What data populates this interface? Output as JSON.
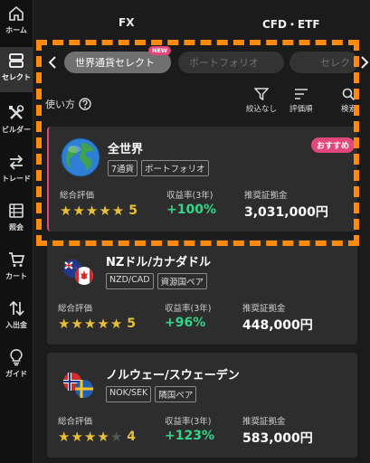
{
  "nav": [
    {
      "label": "ホーム",
      "icon": "home-icon"
    },
    {
      "label": "セレクト",
      "icon": "select-list-icon"
    },
    {
      "label": "ビルダー",
      "icon": "tools-icon"
    },
    {
      "label": "トレード",
      "icon": "trade-arrows-icon"
    },
    {
      "label": "照会",
      "icon": "inquiry-icon"
    },
    {
      "label": "カート",
      "icon": "cart-icon"
    },
    {
      "label": "入出金",
      "icon": "transfer-icon"
    },
    {
      "label": "ガイド",
      "icon": "lightbulb-icon"
    }
  ],
  "tabs": {
    "fx": "FX",
    "cfd": "CFD・ETF"
  },
  "chips": {
    "selected": "世界通貨セレクト",
    "new_badge": "NEW",
    "portfolio": "ポートフォリオ",
    "partial": "セレク"
  },
  "tools": {
    "usage": "使い方",
    "filter": "絞込なし",
    "sort": "評価順",
    "search": "検索"
  },
  "labels": {
    "rating": "総合評価",
    "return": "収益率(3年)",
    "margin": "推奨証拠金"
  },
  "cards": [
    {
      "name": "全世界",
      "tags": [
        "7通貨",
        "ポートフォリオ"
      ],
      "badge": "おすすめ",
      "stars": 5,
      "rating": "5",
      "return": "+100%",
      "margin": "3,031,000円"
    },
    {
      "name": "NZドル/カナダドル",
      "tags": [
        "NZD/CAD",
        "資源国ペア"
      ],
      "stars": 5,
      "rating": "5",
      "return": "+96%",
      "margin": "448,000円"
    },
    {
      "name": "ノルウェー/スウェーデン",
      "tags": [
        "NOK/SEK",
        "隣国ペア"
      ],
      "stars": 4,
      "rating": "4",
      "return": "+123%",
      "margin": "583,000円"
    }
  ],
  "colors": {
    "accent_pink": "#e2477a",
    "star_gold": "#e7bf39",
    "positive_green": "#32d58a",
    "highlight_orange": "#ff8a0e"
  }
}
